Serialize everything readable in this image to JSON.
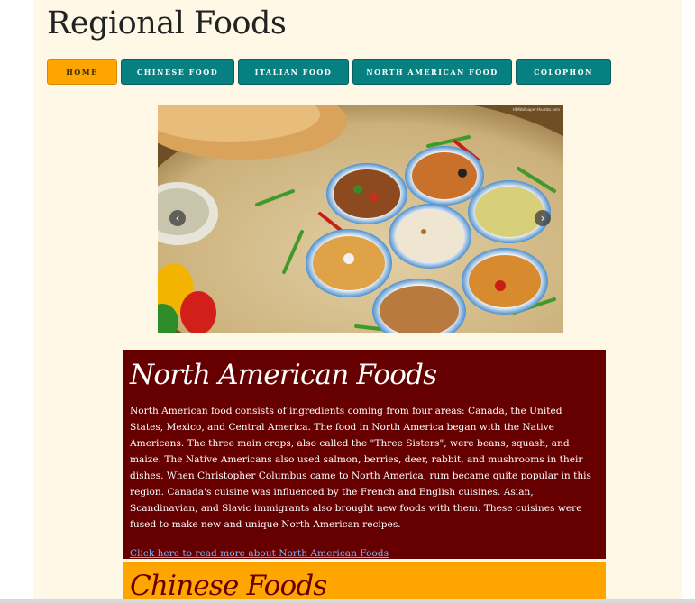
{
  "site": {
    "title": "Regional Foods"
  },
  "nav": {
    "items": [
      {
        "label": "Home",
        "active": true
      },
      {
        "label": "Chinese Food",
        "active": false
      },
      {
        "label": "Italian Food",
        "active": false
      },
      {
        "label": "North American Food",
        "active": false
      },
      {
        "label": "Colophon",
        "active": false
      }
    ]
  },
  "slider": {
    "image_description": "platter of bowls with assorted dishes, flatbread and peppers",
    "prev_icon": "chevron-left-icon",
    "next_icon": "chevron-right-icon",
    "prev_glyph": "‹",
    "next_glyph": "›",
    "watermark": "HDWallpaper-thumbs.com"
  },
  "sections": {
    "north_american": {
      "heading": "North American Foods",
      "body": "North American food consists of ingredients coming from four areas: Canada, the United States, Mexico, and Central America. The food in North America began with the Native Americans. The three main crops, also called the \"Three Sisters\", were beans, squash, and maize. The Native Americans also used salmon, berries, deer, rabbit, and mushrooms in their dishes. When Christopher Columbus came to North America, rum became quite popular in this region. Canada's cuisine was influenced by the French and English cuisines. Asian, Scandinavian, and Slavic immigrants also brought new foods with them. These cuisines were fused to make new and unique North American recipes.",
      "link": "Click here to read more about North American Foods"
    },
    "chinese": {
      "heading": "Chinese Foods"
    }
  },
  "colors": {
    "page_bg": "#fff8e7",
    "nav_teal": "#078081",
    "nav_active": "#ffa500",
    "na_section_bg": "#660000",
    "cn_section_bg": "#ffa500",
    "link": "#7fb4ff"
  }
}
